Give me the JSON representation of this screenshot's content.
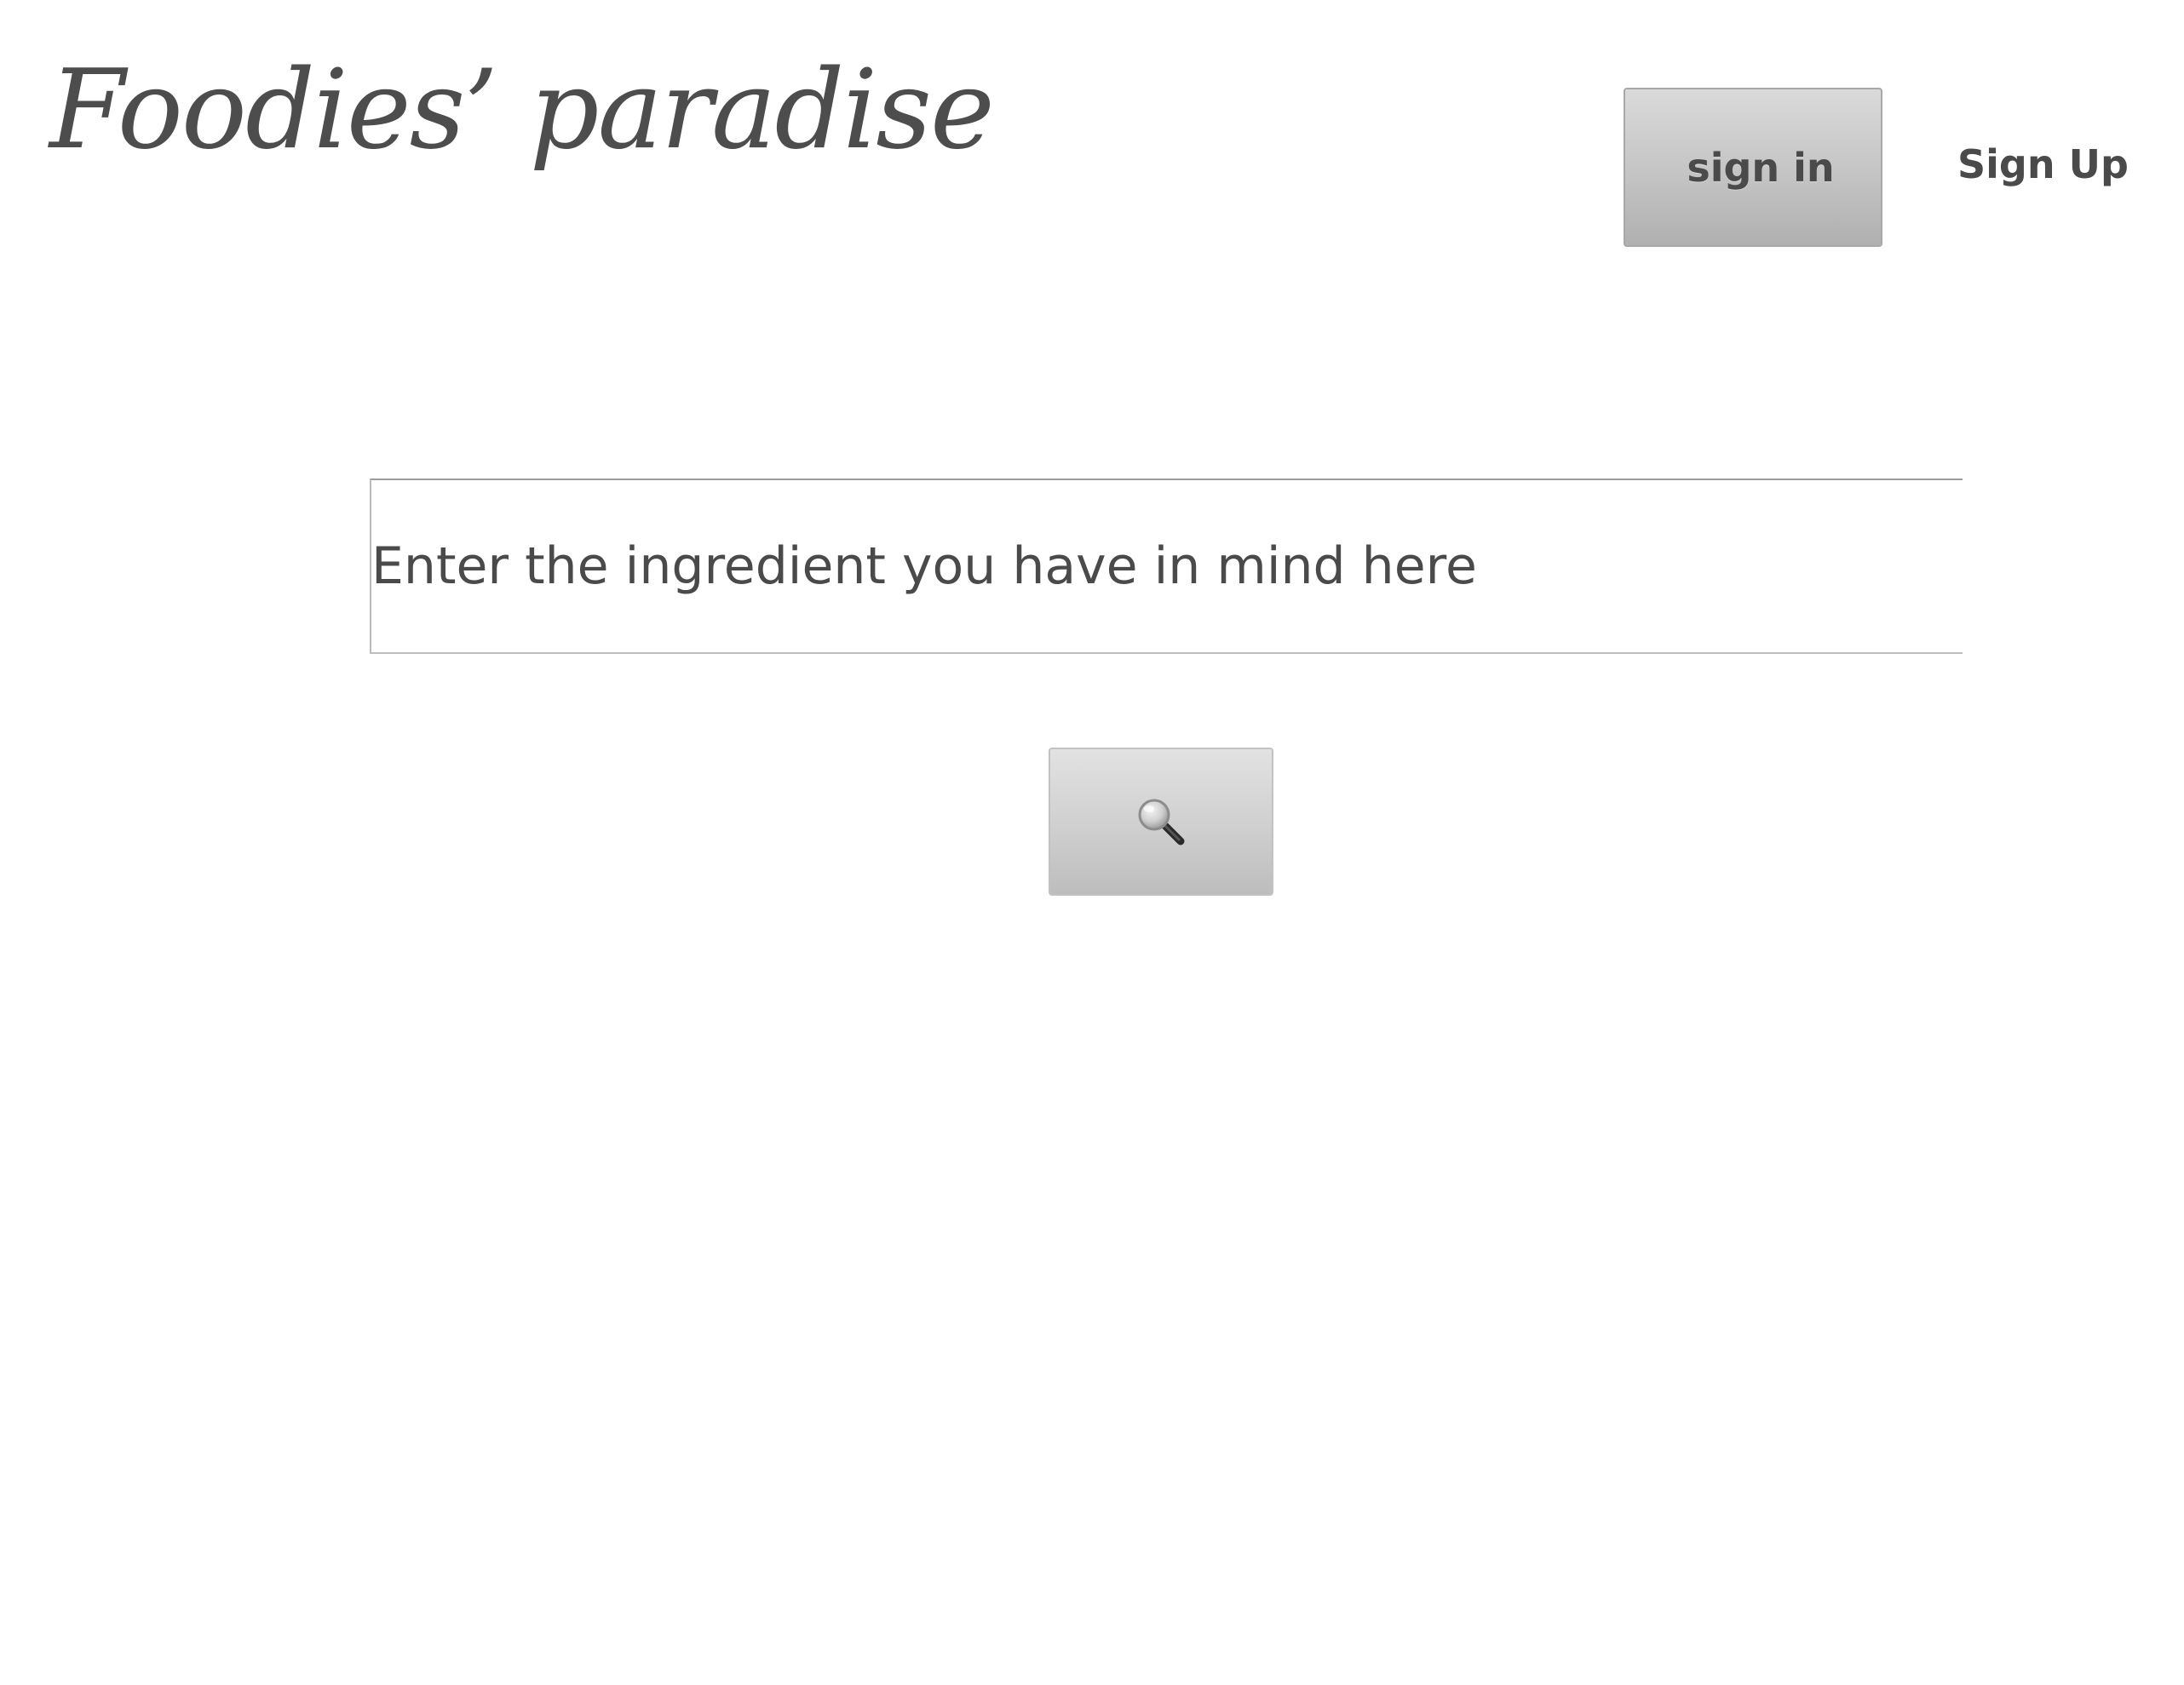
{
  "header": {
    "title": "Foodies’ paradise",
    "signin_label": "sign in",
    "signup_label": "Sign Up"
  },
  "search": {
    "placeholder": "Enter the ingredient you have in mind here",
    "value": "",
    "button_icon": "search-icon"
  },
  "colors": {
    "text": "#4a4a4a",
    "button_top": "#dadada",
    "button_bottom": "#b0b0b0",
    "background": "#ffffff"
  }
}
